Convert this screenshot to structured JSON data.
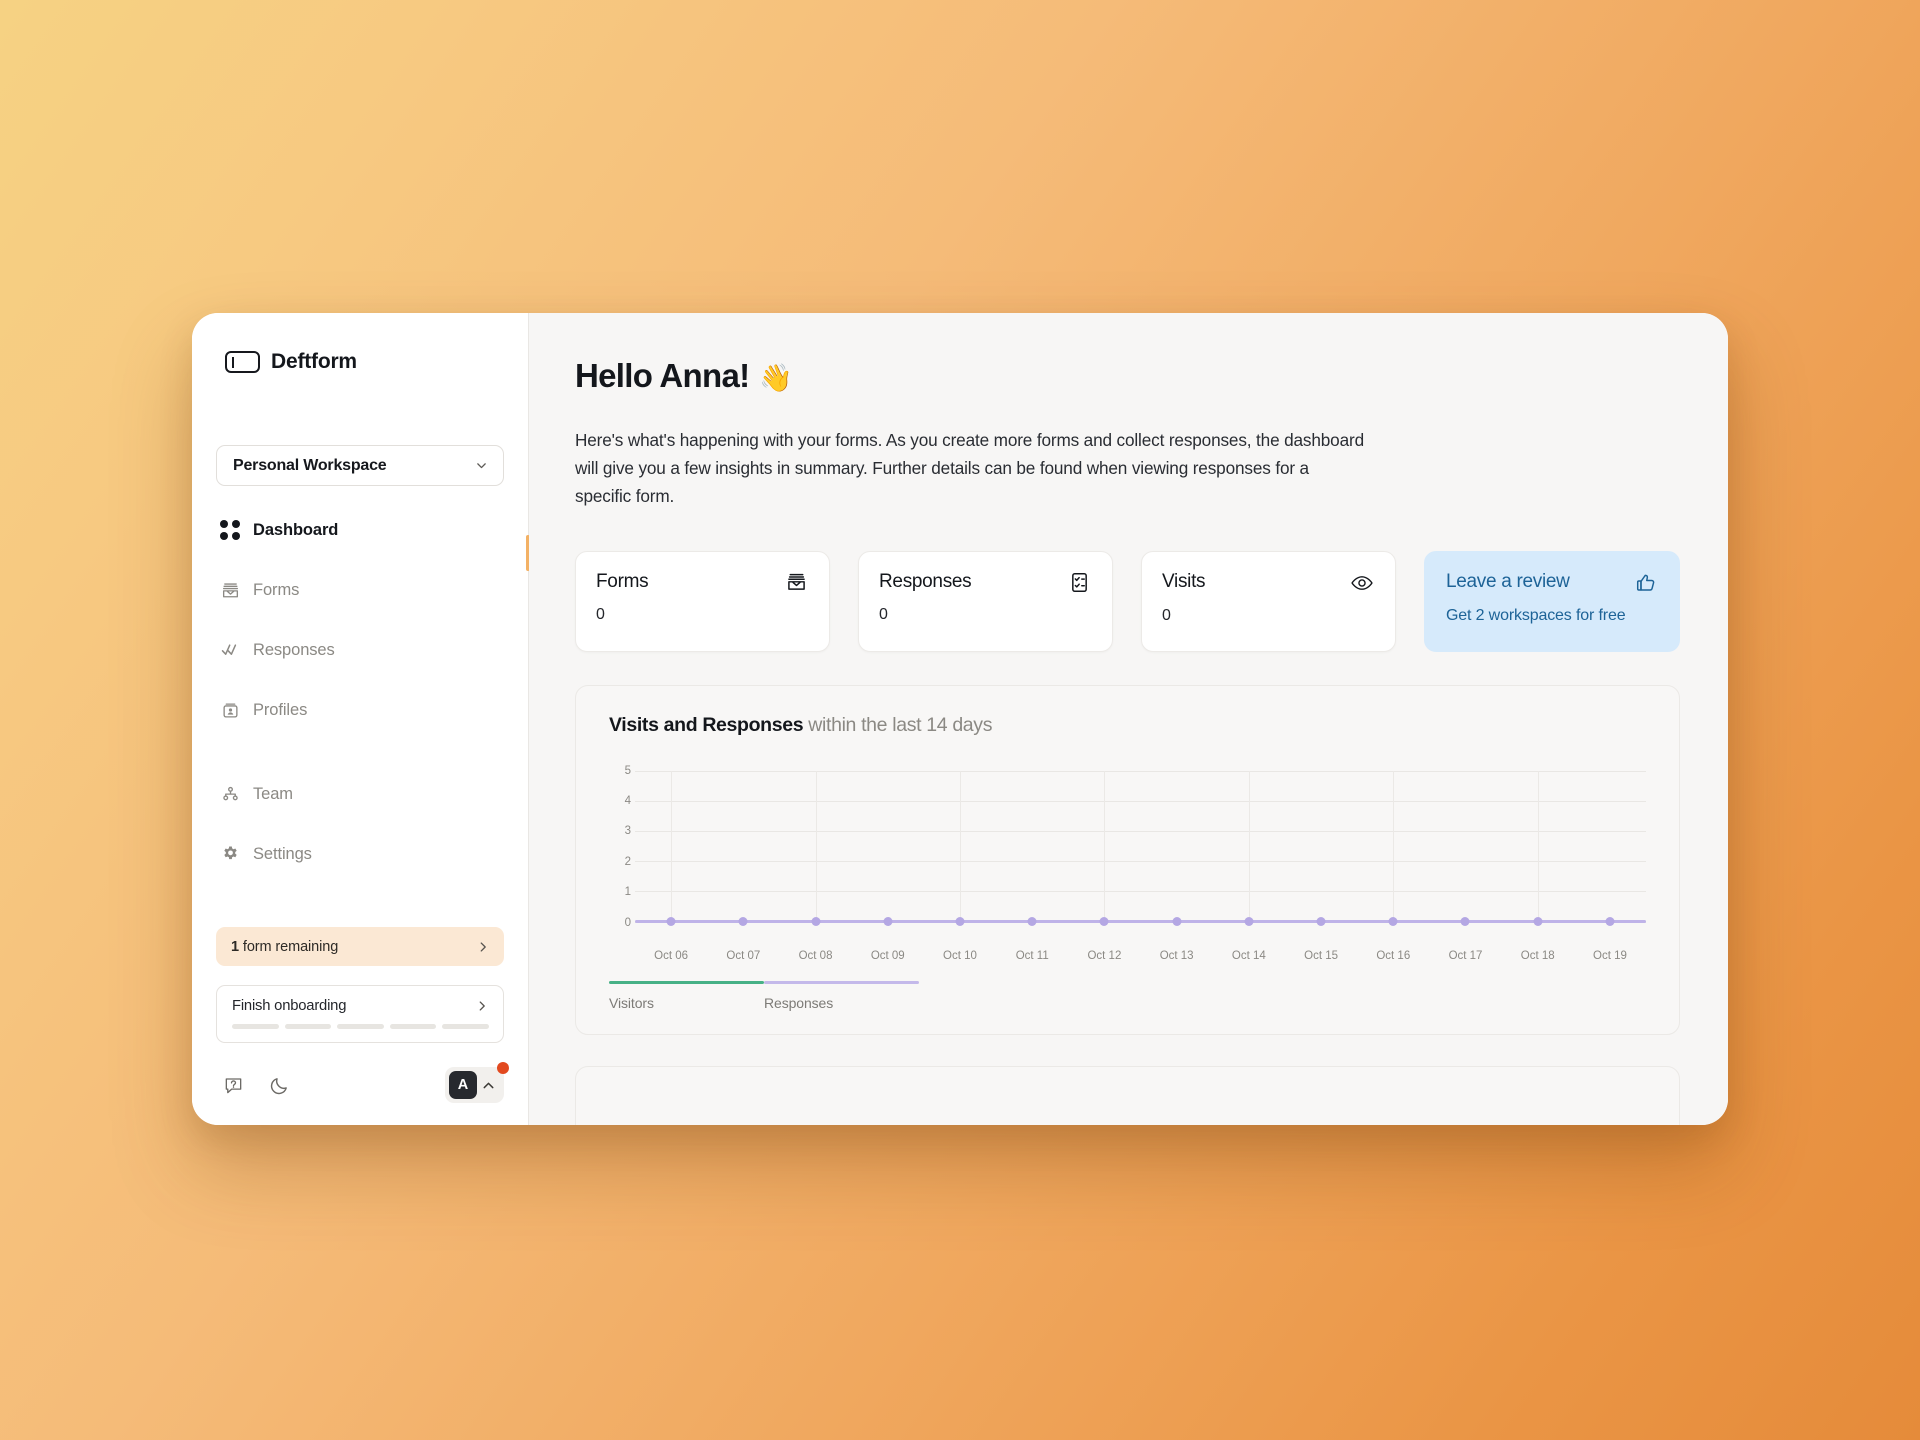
{
  "brand": {
    "name": "Deftform",
    "logo_icon": "text-cursor-box-icon"
  },
  "sidebar": {
    "workspace": {
      "label": "Personal Workspace",
      "chevron_icon": "chevron-down-icon"
    },
    "nav": [
      {
        "label": "Dashboard",
        "icon": "grid-dots-icon",
        "active": true
      },
      {
        "label": "Forms",
        "icon": "forms-tray-icon",
        "active": false
      },
      {
        "label": "Responses",
        "icon": "double-check-icon",
        "active": false
      },
      {
        "label": "Profiles",
        "icon": "profile-card-icon",
        "active": false
      },
      {
        "label": "Team",
        "icon": "team-icon",
        "active": false
      },
      {
        "label": "Settings",
        "icon": "gear-icon",
        "active": false
      }
    ],
    "forms_remaining": {
      "count": "1",
      "text": " form remaining",
      "chevron_icon": "chevron-right-icon",
      "bg_color": "#fbe8d4"
    },
    "onboarding": {
      "label": "Finish onboarding",
      "chevron_icon": "chevron-right-icon",
      "steps_total": 5,
      "steps_done": 0
    },
    "tools": {
      "help_icon": "help-chat-icon",
      "theme_icon": "moon-icon"
    },
    "user": {
      "initial": "A",
      "chevron_icon": "chevron-up-icon",
      "has_notification": true,
      "notification_color": "#e2491f"
    },
    "accent_color": "#f3b165"
  },
  "main": {
    "greeting": "Hello Anna!",
    "greeting_emoji": "👋",
    "intro": "Here's what's happening with your forms. As you create more forms and collect responses, the dashboard will give you a few insights in summary. Further details can be found when viewing responses for a specific form.",
    "stats": [
      {
        "title": "Forms",
        "value": "0",
        "icon": "forms-tray-icon"
      },
      {
        "title": "Responses",
        "value": "0",
        "icon": "checklist-icon"
      },
      {
        "title": "Visits",
        "value": "0",
        "icon": "eye-icon"
      }
    ],
    "review": {
      "title": "Leave a review",
      "subtitle": "Get 2 workspaces for free",
      "icon": "thumbs-up-icon",
      "bg_color": "#d6eafb",
      "text_color": "#1d6397"
    }
  },
  "chart_data": {
    "type": "line",
    "title": "Visits and Responses",
    "title_suffix": "within the last 14 days",
    "xlabel": "",
    "ylabel": "",
    "ylim": [
      0,
      5
    ],
    "yticks": [
      "5",
      "4",
      "3",
      "2",
      "1",
      "0"
    ],
    "grid": true,
    "legend_position": "bottom-left",
    "categories": [
      "Oct 06",
      "Oct 07",
      "Oct 08",
      "Oct 09",
      "Oct 10",
      "Oct 11",
      "Oct 12",
      "Oct 13",
      "Oct 14",
      "Oct 15",
      "Oct 16",
      "Oct 17",
      "Oct 18",
      "Oct 19"
    ],
    "series": [
      {
        "name": "Visitors",
        "color": "#47b186",
        "values": [
          0,
          0,
          0,
          0,
          0,
          0,
          0,
          0,
          0,
          0,
          0,
          0,
          0,
          0
        ]
      },
      {
        "name": "Responses",
        "color": "#c4b9ea",
        "values": [
          0,
          0,
          0,
          0,
          0,
          0,
          0,
          0,
          0,
          0,
          0,
          0,
          0,
          0
        ]
      }
    ]
  }
}
